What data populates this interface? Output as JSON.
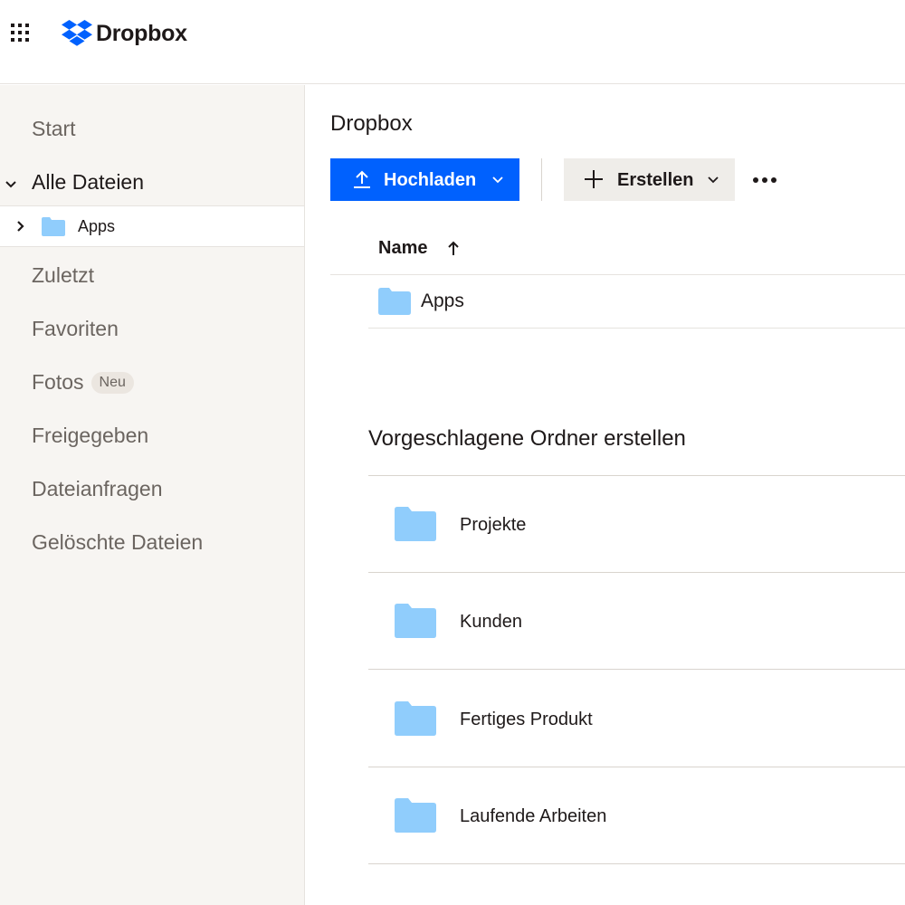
{
  "header": {
    "brand_name": "Dropbox",
    "brand_color": "#0061fe",
    "apps_icon": "grid-icon"
  },
  "sidebar": {
    "items": [
      {
        "label": "Start",
        "active": false
      },
      {
        "label": "Alle Dateien",
        "active": true,
        "expanded": true
      },
      {
        "label": "Zuletzt",
        "active": false
      },
      {
        "label": "Favoriten",
        "active": false
      },
      {
        "label": "Fotos",
        "active": false,
        "badge": "Neu"
      },
      {
        "label": "Freigegeben",
        "active": false
      },
      {
        "label": "Dateianfragen",
        "active": false
      },
      {
        "label": "Gelöschte Dateien",
        "active": false
      }
    ],
    "tree_child": {
      "label": "Apps",
      "icon": "folder-icon"
    }
  },
  "main": {
    "title": "Dropbox",
    "toolbar": {
      "upload_label": "Hochladen",
      "create_label": "Erstellen",
      "more_icon": "more-icon"
    },
    "table": {
      "name_header": "Name",
      "sort": "ascending",
      "rows": [
        {
          "name": "Apps",
          "icon": "folder-icon"
        }
      ]
    },
    "suggestions": {
      "title": "Vorgeschlagene Ordner erstellen",
      "folders": [
        {
          "name": "Projekte"
        },
        {
          "name": "Kunden"
        },
        {
          "name": "Fertiges Produkt"
        },
        {
          "name": "Laufende Arbeiten"
        }
      ]
    }
  },
  "colors": {
    "primary_button": "#0061fe",
    "folder": "#90cdfc",
    "sidebar_bg": "#f7f5f2"
  }
}
